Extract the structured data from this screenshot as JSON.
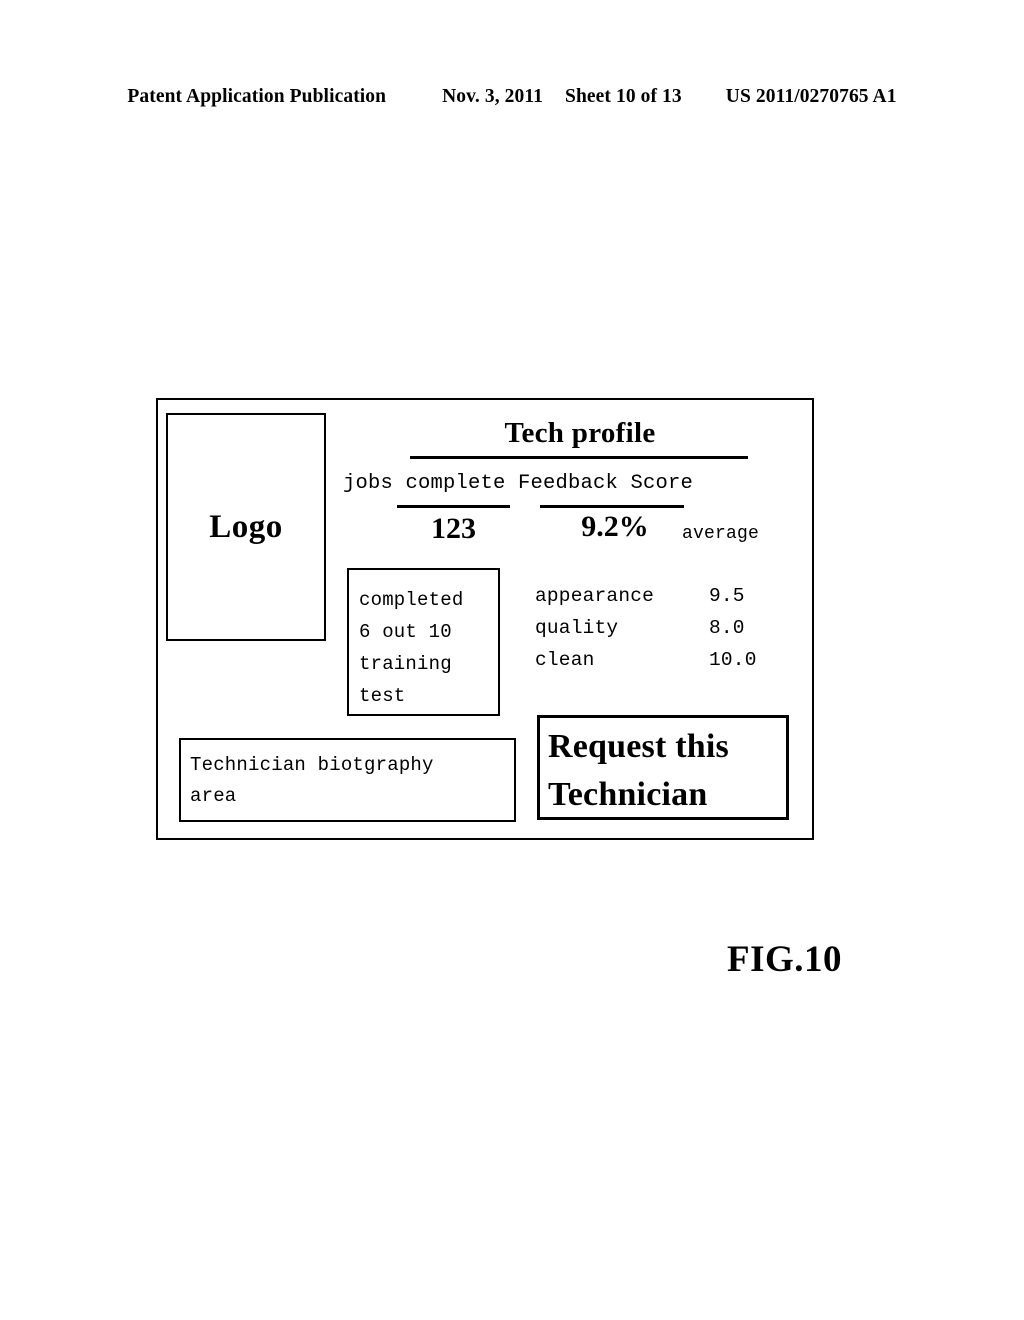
{
  "page_header": {
    "publication": "Patent Application Publication",
    "date": "Nov. 3, 2011",
    "sheet": "Sheet 10 of 13",
    "document_number": "US 2011/0270765 A1"
  },
  "figure": {
    "label": "FIG.10"
  },
  "screen": {
    "logo": {
      "text": "Logo"
    },
    "title": "Tech profile",
    "stats": {
      "labels_line": "jobs complete Feedback Score",
      "jobs_complete_label": "jobs complete",
      "feedback_score_label": "Feedback Score",
      "jobs_complete_value": "123",
      "feedback_score_value": "9.2%",
      "feedback_score_qualifier": "average"
    },
    "training_box": {
      "lines": [
        "completed",
        "6 out 10",
        "training",
        "test"
      ]
    },
    "ratings": {
      "rows": [
        {
          "name": "appearance",
          "score": "9.5"
        },
        {
          "name": "quality",
          "score": "8.0"
        },
        {
          "name": "clean",
          "score": "10.0"
        }
      ]
    },
    "biography_box": {
      "lines": [
        "Technician biotgraphy",
        "area"
      ]
    },
    "request_button": {
      "lines": [
        "Request this",
        "Technician"
      ]
    }
  },
  "colors": {
    "ink": "#000000",
    "paper": "#ffffff"
  }
}
